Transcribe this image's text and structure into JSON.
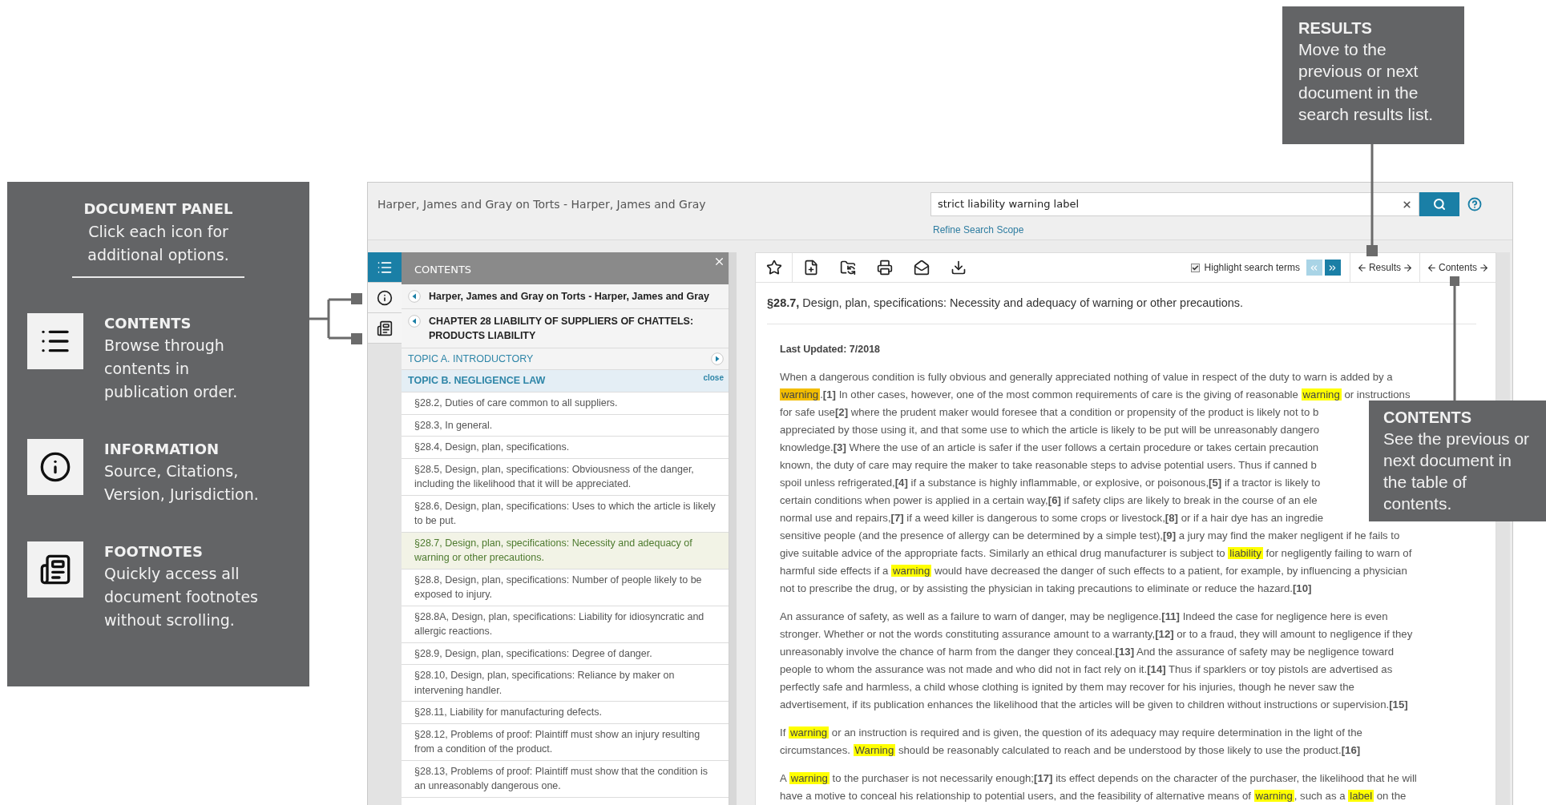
{
  "callouts": {
    "document_panel": {
      "title": "DOCUMENT PANEL",
      "text": "Click each icon for additional options.",
      "items": [
        {
          "kind": "contents",
          "title": "CONTENTS",
          "text": "Browse through contents in publication order."
        },
        {
          "kind": "information",
          "title": "INFORMATION",
          "text": "Source, Citations, Version, Jurisdiction."
        },
        {
          "kind": "footnotes",
          "title": "FOOTNOTES",
          "text": "Quickly access all document footnotes without scrolling."
        }
      ]
    },
    "results": {
      "title": "RESULTS",
      "text": "Move to the previous or next document in the search results list."
    },
    "contents": {
      "title": "CONTENTS",
      "text": "See the previous or next document in the table of contents."
    }
  },
  "app": {
    "document_title": "Harper, James and Gray on Torts - Harper, James and Gray",
    "search": {
      "value": "strict liability warning label",
      "refine_link": "Refine Search Scope"
    },
    "rail": [
      {
        "kind": "contents",
        "selected": true
      },
      {
        "kind": "information",
        "selected": false
      },
      {
        "kind": "footnotes",
        "selected": false
      }
    ],
    "contents_panel": {
      "title": "CONTENTS",
      "entries": [
        {
          "kind": "heading",
          "text": "Harper, James and Gray on Torts - Harper, James and Gray"
        },
        {
          "kind": "heading",
          "text": "CHAPTER 28 LIABILITY OF SUPPLIERS OF CHATTELS: PRODUCTS LIABILITY"
        },
        {
          "kind": "topic",
          "text": "TOPIC A. INTRODUCTORY",
          "expanded": false
        },
        {
          "kind": "topic",
          "text": "TOPIC B. NEGLIGENCE LAW",
          "expanded": true,
          "close_label": "close"
        },
        {
          "kind": "section",
          "text": "§28.2, Duties of care common to all suppliers.",
          "selected": false
        },
        {
          "kind": "section",
          "text": "§28.3, In general.",
          "selected": false
        },
        {
          "kind": "section",
          "text": "§28.4, Design, plan, specifications.",
          "selected": false
        },
        {
          "kind": "section",
          "text": "§28.5, Design, plan, specifications: Obviousness of the danger, including the likelihood that it will be appreciated.",
          "selected": false
        },
        {
          "kind": "section",
          "text": "§28.6, Design, plan, specifications: Uses to which the article is likely to be put.",
          "selected": false
        },
        {
          "kind": "section",
          "text": "§28.7, Design, plan, specifications: Necessity and adequacy of warning or other precautions.",
          "selected": true
        },
        {
          "kind": "section",
          "text": "§28.8, Design, plan, specifications: Number of people likely to be exposed to injury.",
          "selected": false
        },
        {
          "kind": "section",
          "text": "§28.8A, Design, plan, specifications: Liability for idiosyncratic and allergic reactions.",
          "selected": false
        },
        {
          "kind": "section",
          "text": "§28.9, Design, plan, specifications: Degree of danger.",
          "selected": false
        },
        {
          "kind": "section",
          "text": "§28.10, Design, plan, specifications: Reliance by maker on intervening handler.",
          "selected": false
        },
        {
          "kind": "section",
          "text": "§28.11, Liability for manufacturing defects.",
          "selected": false
        },
        {
          "kind": "section",
          "text": "§28.12, Problems of proof: Plaintiff must show an injury resulting from a condition of the product.",
          "selected": false
        },
        {
          "kind": "section",
          "text": "§28.13, Problems of proof: Plaintiff must show that the condition is an unreasonably dangerous one.",
          "selected": false
        }
      ]
    },
    "toolbar": {
      "highlight": {
        "label": "Highlight search terms",
        "checked": true
      },
      "term_nav": [
        {
          "kind": "previous",
          "disabled": true
        },
        {
          "kind": "next",
          "disabled": false
        }
      ],
      "results_label": "Results",
      "contents_label": "Contents"
    },
    "document": {
      "heading": "**§28.7,** Design, plan, specifications: Necessity and adequacy of warning or other precautions.",
      "last_updated": "Last Updated: 7/2018",
      "paragraphs": [
        [
          [
            {
              "text": "When a dangerous condition is fully obvious and generally appreciated nothing of value in respect of the duty to warn is added by a"
            }
          ],
          [
            {
              "text": "warning",
              "highlighted": true,
              "current": true
            },
            {
              "text": ".**[1]** In other cases, however, one of the most common requirements of care is the giving of reasonable "
            },
            {
              "text": "warning",
              "highlighted": true,
              "current": false
            },
            {
              "text": " or instructions"
            }
          ],
          [
            {
              "text": "for safe use**[2]** where the prudent maker would foresee that a condition or propensity of the product is likely not to b"
            }
          ],
          [
            {
              "text": "appreciated by those using it, and that some use to which the article is likely to be put will be unreasonably dangero"
            }
          ],
          [
            {
              "text": "knowledge.**[3]** Where the use of an article is safer if the user follows a certain procedure or takes certain precaution"
            }
          ],
          [
            {
              "text": "known, the duty of care may require the maker to take reasonable steps to advise potential users. Thus if canned b"
            }
          ],
          [
            {
              "text": "spoil unless refrigerated,**[4]** if a substance is highly inflammable, or explosive, or poisonous,**[5]** if a tractor is likely to"
            }
          ],
          [
            {
              "text": "certain conditions when power is applied in a certain way,**[6]** if safety clips are likely to break in the course of an ele"
            }
          ],
          [
            {
              "text": "normal use and repairs,**[7]** if a weed killer is dangerous to some crops or livestock,**[8]** or if a hair dye has an ingredie"
            }
          ],
          [
            {
              "text": "sensitive people (and the presence of allergy can be determined by a simple test),**[9]** a jury may find the maker negligent if he fails to"
            }
          ],
          [
            {
              "text": "give suitable advice of the appropriate facts. Similarly an ethical drug manufacturer is subject to "
            },
            {
              "text": "liability",
              "highlighted": true,
              "current": false
            },
            {
              "text": " for negligently failing to warn of"
            }
          ],
          [
            {
              "text": "harmful side effects if a "
            },
            {
              "text": "warning",
              "highlighted": true,
              "current": false
            },
            {
              "text": " would have decreased the danger of such effects to a patient, for example, by influencing a physician"
            }
          ],
          [
            {
              "text": "not to prescribe the drug, or by assisting the physician in taking precautions to eliminate or reduce the hazard.**[10]**"
            }
          ]
        ],
        [
          [
            {
              "text": "An assurance of safety, as well as a failure to warn of danger, may be negligence.**[11]** Indeed the case for negligence here is even"
            }
          ],
          [
            {
              "text": "stronger. Whether or not the words constituting assurance amount to a warranty,**[12]** or to a fraud, they will amount to negligence if they"
            }
          ],
          [
            {
              "text": "unreasonably involve the chance of harm from the danger they conceal.**[13]** And the assurance of safety may be negligence toward"
            }
          ],
          [
            {
              "text": "people to whom the assurance was not made and who did not in fact rely on it.**[14]** Thus if sparklers or toy pistols are advertised as"
            }
          ],
          [
            {
              "text": "perfectly safe and harmless, a child whose clothing is ignited by them may recover for his injuries, though he never saw the"
            }
          ],
          [
            {
              "text": "advertisement, if its publication enhances the likelihood that the articles will be given to children without instructions or supervision.**[15]**"
            }
          ]
        ],
        [
          [
            {
              "text": "If "
            },
            {
              "text": "warning",
              "highlighted": true,
              "current": false
            },
            {
              "text": " or an instruction is required and is given, the question of its adequacy may require determination in the light of the"
            }
          ],
          [
            {
              "text": "circumstances. "
            },
            {
              "text": "Warning",
              "highlighted": true,
              "current": false
            },
            {
              "text": " should be reasonably calculated to reach and be understood by those likely to use the product.**[16]**"
            }
          ]
        ],
        [
          [
            {
              "text": "A "
            },
            {
              "text": "warning",
              "highlighted": true,
              "current": false
            },
            {
              "text": " to the purchaser is not necessarily enough;**[17]** its effect depends on the character of the purchaser, the likelihood that he will"
            }
          ],
          [
            {
              "text": "have a motive to conceal his relationship to potential users, and the feasibility of alternative means of "
            },
            {
              "text": "warning",
              "highlighted": true,
              "current": false
            },
            {
              "text": ", such as a "
            },
            {
              "text": "label",
              "highlighted": true,
              "current": false
            },
            {
              "text": " on the"
            }
          ]
        ]
      ]
    }
  }
}
